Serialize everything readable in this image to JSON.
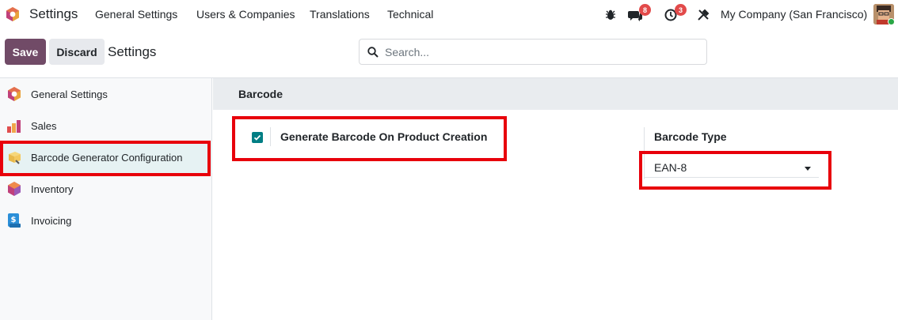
{
  "navbar": {
    "app_name": "Settings",
    "menu": [
      "General Settings",
      "Users & Companies",
      "Translations",
      "Technical"
    ],
    "chat_badge": "8",
    "activity_badge": "3",
    "company": "My Company (San Francisco)",
    "icons": [
      "odoo-logo-icon",
      "bug-icon",
      "chat-icon",
      "clock-icon",
      "tools-icon",
      "user-avatar"
    ]
  },
  "control": {
    "save_label": "Save",
    "discard_label": "Discard",
    "title": "Settings",
    "search_placeholder": "Search..."
  },
  "sidebar": {
    "items": [
      {
        "label": "General Settings",
        "icon": "odoo-logo-icon"
      },
      {
        "label": "Sales",
        "icon": "sales-chart-icon"
      },
      {
        "label": "Barcode Generator Configuration",
        "icon": "barcode-box-icon",
        "active": true
      },
      {
        "label": "Inventory",
        "icon": "inventory-box-icon"
      },
      {
        "label": "Invoicing",
        "icon": "invoicing-icon"
      }
    ]
  },
  "content": {
    "section_title": "Barcode",
    "generate_label": "Generate Barcode On Product Creation",
    "generate_checked": true,
    "barcode_type_label": "Barcode Type",
    "barcode_type_value": "EAN-8"
  },
  "colors": {
    "brand": "#714b67",
    "teal": "#017e84",
    "highlight": "#e8000b",
    "badge": "#e24a4a"
  }
}
